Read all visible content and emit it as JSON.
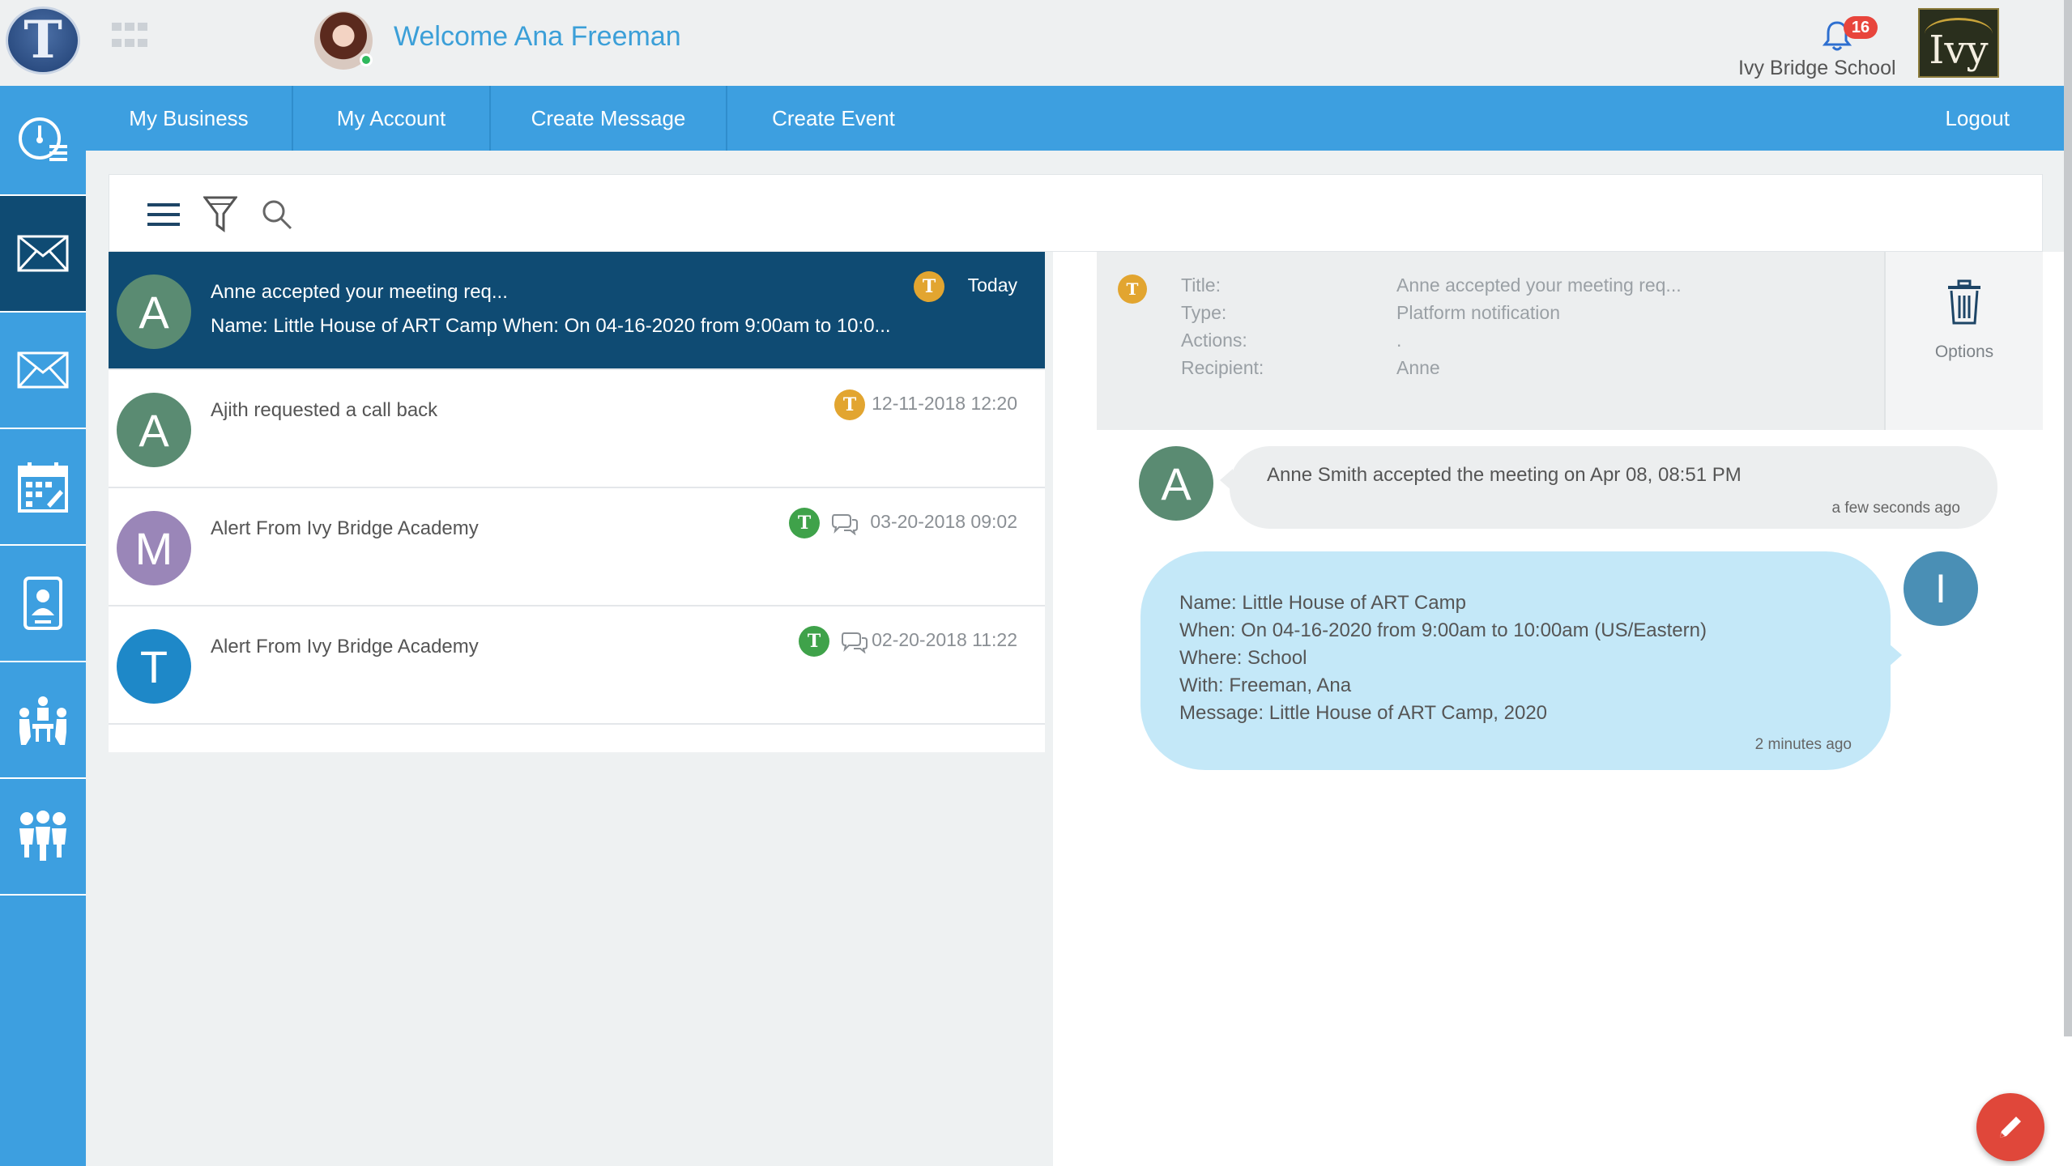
{
  "header": {
    "logo_letter": "T",
    "welcome": "Welcome Ana Freeman",
    "notifications_count": "16",
    "school_name": "Ivy Bridge School",
    "school_logo_text": "Ivy"
  },
  "nav": {
    "items": [
      "My Business",
      "My Account",
      "Create Message",
      "Create Event"
    ],
    "logout": "Logout"
  },
  "sidebar": {
    "items": [
      "dashboard-icon",
      "inbox-icon",
      "mail-icon",
      "calendar-icon",
      "contact-icon",
      "meeting-icon",
      "groups-icon"
    ],
    "active": "inbox-icon"
  },
  "toolbar": {
    "icons": [
      "menu-icon",
      "filter-icon",
      "search-icon"
    ]
  },
  "messages": [
    {
      "avatar_letter": "A",
      "avatar_color": "#5a8b72",
      "title": "Anne accepted your meeting req...",
      "preview": "Name: Little House of ART Camp When: On 04-16-2020 from 9:00am to 10:0...",
      "date": "Today",
      "source_color": "#e2a530"
    },
    {
      "avatar_letter": "A",
      "avatar_color": "#5a8b72",
      "title": "Ajith requested a call back",
      "preview": "",
      "date": "12-11-2018 12:20",
      "source_color": "#e2a530"
    },
    {
      "avatar_letter": "M",
      "avatar_color": "#9a86b8",
      "title": "Alert From Ivy Bridge Academy",
      "preview": "",
      "date": "03-20-2018 09:02",
      "source_color": "#3fa24a"
    },
    {
      "avatar_letter": "T",
      "avatar_color": "#1e88c8",
      "title": "Alert From Ivy Bridge Academy",
      "preview": "",
      "date": "02-20-2018 11:22",
      "source_color": "#3fa24a"
    }
  ],
  "detail": {
    "labels": {
      "title": "Title:",
      "type": "Type:",
      "actions": "Actions:",
      "recipient": "Recipient:"
    },
    "values": {
      "title": "Anne accepted your meeting req...",
      "type": "Platform notification",
      "actions": ".",
      "recipient": "Anne"
    },
    "options_label": "Options",
    "incoming": {
      "avatar_letter": "A",
      "text": "Anne Smith accepted the meeting on Apr 08, 08:51 PM",
      "time": "a few seconds ago"
    },
    "outgoing": {
      "avatar_letter": "I",
      "lines": [
        "Name: Little House of ART Camp",
        "When: On 04-16-2020 from 9:00am to 10:00am (US/Eastern)",
        "Where: School",
        "With:  Freeman, Ana",
        "Message:  Little House of ART Camp, 2020"
      ],
      "time": "2 minutes ago"
    }
  },
  "colors": {
    "accent": "#3d9fe0",
    "active": "#0f4b73",
    "fab": "#e0473a"
  }
}
